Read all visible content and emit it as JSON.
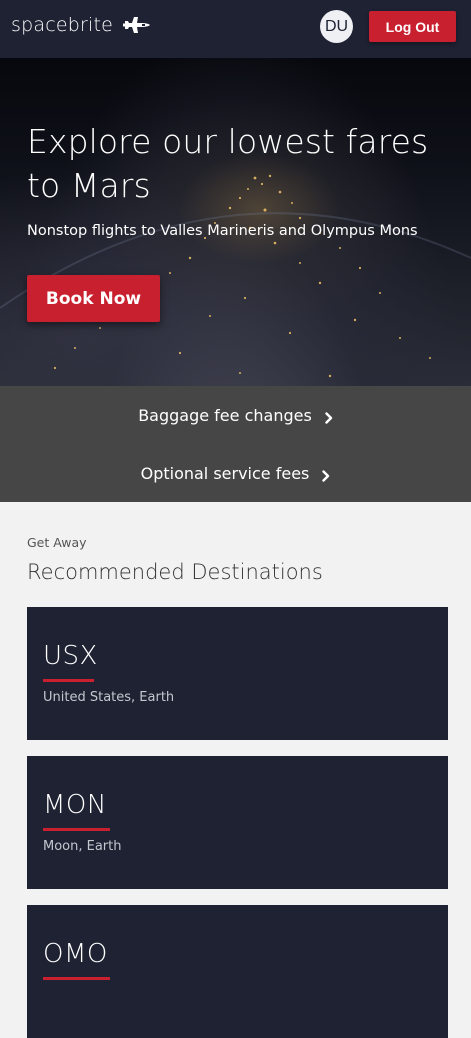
{
  "header": {
    "brand": "spacebrite",
    "brand_icon": "shuttle-icon",
    "avatar_initials": "DU",
    "logout_label": "Log Out"
  },
  "hero": {
    "title": "Explore our lowest fares to Mars",
    "subtitle": "Nonstop flights to Valles Marineris and Olympus Mons",
    "cta_label": "Book Now"
  },
  "notices": [
    {
      "label": "Baggage fee changes",
      "icon": "chevron-right-icon"
    },
    {
      "label": "Optional service fees",
      "icon": "chevron-right-icon"
    }
  ],
  "destinations_section": {
    "kicker": "Get Away",
    "title": "Recommended Destinations"
  },
  "destinations": [
    {
      "code": "USX",
      "location": "United States, Earth"
    },
    {
      "code": "MON",
      "location": "Moon, Earth"
    },
    {
      "code": "OMO",
      "location": ""
    }
  ],
  "colors": {
    "navbar": "#1e2233",
    "accent_red": "#c8202f",
    "notice_bar": "#464646",
    "page_bg": "#f2f2f2",
    "card_bg": "#1e2233"
  }
}
